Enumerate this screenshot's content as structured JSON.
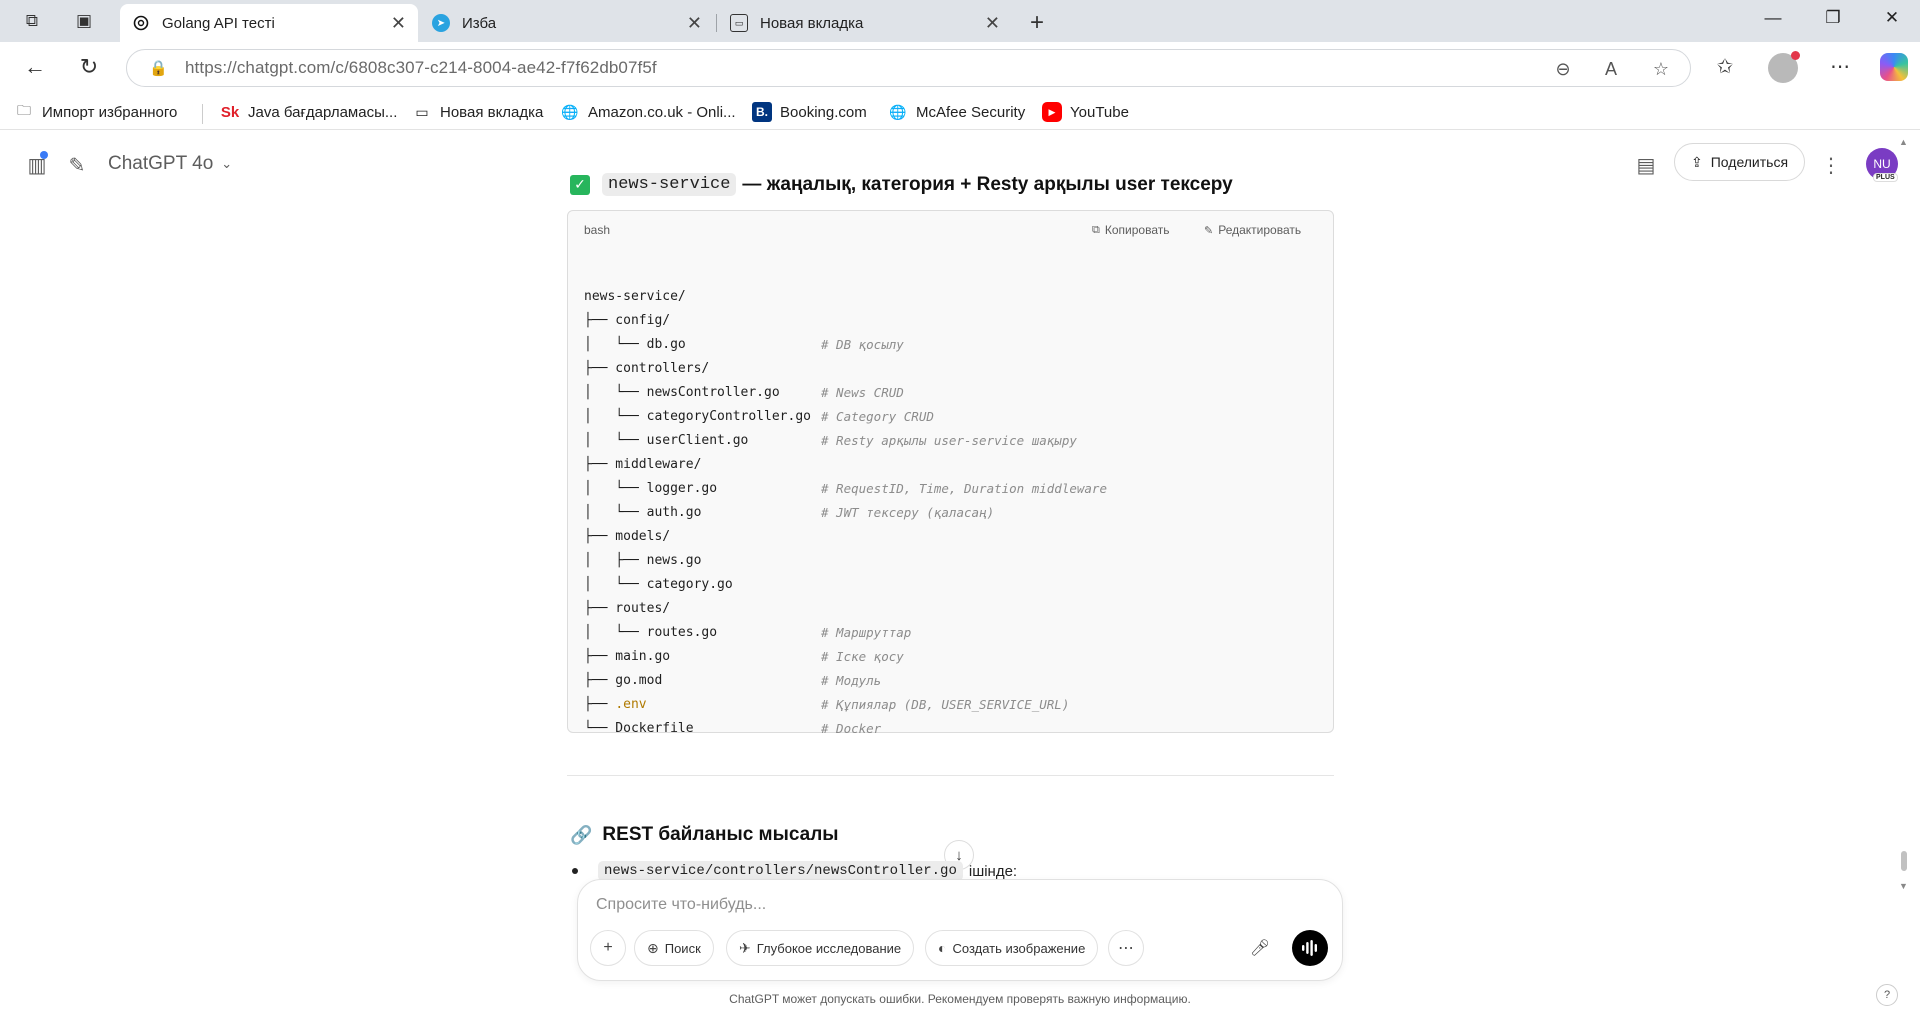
{
  "browser": {
    "tabs": [
      {
        "title": "Golang API тесті",
        "active": true
      },
      {
        "title": "Изба",
        "active": false
      },
      {
        "title": "Новая вкладка",
        "active": false
      }
    ],
    "url_host": "https://chatgpt.com",
    "url_path": "/c/6808c307-c214-8004-ae42-f7f62db07f5f"
  },
  "bookmarks": [
    {
      "label": "Импорт избранного",
      "icon": "folder-import-icon"
    },
    {
      "label": "Java бағдарламасы...",
      "icon": "sk-icon"
    },
    {
      "label": "Новая вкладка",
      "icon": "newtab-icon"
    },
    {
      "label": "Amazon.co.uk - Onli...",
      "icon": "globe-icon"
    },
    {
      "label": "Booking.com",
      "icon": "booking-icon"
    },
    {
      "label": "McAfee Security",
      "icon": "globe-icon"
    },
    {
      "label": "YouTube",
      "icon": "youtube-icon"
    }
  ],
  "app": {
    "model": "ChatGPT 4o",
    "share_label": "Поделиться",
    "avatar_initials": "NU",
    "avatar_badge": "PLUS"
  },
  "message": {
    "section1": {
      "code_tag": "news-service",
      "title": "— жаңалық, категория + Resty арқылы user тексеру"
    },
    "codeblock": {
      "lang": "bash",
      "copy_label": "Копировать",
      "edit_label": "Редактировать",
      "lines": [
        {
          "text": "",
          "comment": ""
        },
        {
          "text": "news-service/",
          "comment": ""
        },
        {
          "text": "├── config/",
          "comment": ""
        },
        {
          "text": "│   └── db.go",
          "comment": "# DB қосылу"
        },
        {
          "text": "├── controllers/",
          "comment": ""
        },
        {
          "text": "│   └── newsController.go",
          "comment": "# News CRUD"
        },
        {
          "text": "│   └── categoryController.go",
          "comment": "# Category CRUD"
        },
        {
          "text": "│   └── userClient.go",
          "comment": "# Resty арқылы user-service шақыру"
        },
        {
          "text": "├── middleware/",
          "comment": ""
        },
        {
          "text": "│   └── logger.go",
          "comment": "# RequestID, Time, Duration middleware"
        },
        {
          "text": "│   └── auth.go",
          "comment": "# JWT тексеру (қаласаң)"
        },
        {
          "text": "├── models/",
          "comment": ""
        },
        {
          "text": "│   ├── news.go",
          "comment": ""
        },
        {
          "text": "│   └── category.go",
          "comment": ""
        },
        {
          "text": "├── routes/",
          "comment": ""
        },
        {
          "text": "│   └── routes.go",
          "comment": "# Маршруттар"
        },
        {
          "text": "├── main.go",
          "comment": "# Іске қосу"
        },
        {
          "text": "├── go.mod",
          "comment": "# Модуль"
        },
        {
          "text": "├── ",
          "env": ".env",
          "comment": "# Құпиялар (DB, USER_SERVICE_URL)"
        },
        {
          "text": "└── Dockerfile",
          "comment": "# Docker"
        }
      ]
    },
    "section2": {
      "title": "REST байланыс мысалы",
      "bullet_code": "news-service/controllers/newsController.go",
      "bullet_text": "ішінде:"
    }
  },
  "composer": {
    "placeholder": "Спросите что-нибудь...",
    "search_label": "Поиск",
    "research_label": "Глубокое исследование",
    "image_label": "Создать изображение"
  },
  "footer": {
    "disclaimer": "ChatGPT может допускать ошибки. Рекомендуем проверять важную информацию.",
    "help": "?"
  }
}
